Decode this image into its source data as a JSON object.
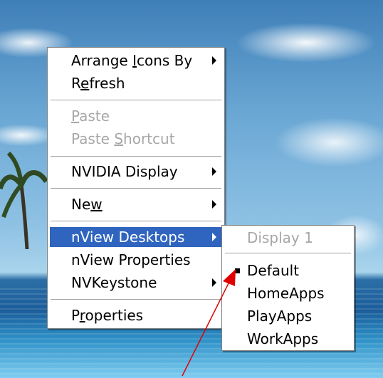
{
  "context_menu": {
    "items": [
      {
        "label": "Arrange Icons By",
        "ul_before": "Arrange ",
        "ul_char": "I",
        "ul_after": "cons By"
      },
      {
        "label": "Refresh",
        "ul_before": "R",
        "ul_char": "e",
        "ul_after": "fresh"
      },
      {
        "label": "Paste",
        "ul_before": "",
        "ul_char": "P",
        "ul_after": "aste"
      },
      {
        "label": "Paste Shortcut",
        "ul_before": "Paste ",
        "ul_char": "S",
        "ul_after": "hortcut"
      },
      {
        "label": "NVIDIA Display"
      },
      {
        "label": "New",
        "ul_before": "Ne",
        "ul_char": "w",
        "ul_after": ""
      },
      {
        "label": "nView Desktops"
      },
      {
        "label": "nView Properties"
      },
      {
        "label": "NVKeystone"
      },
      {
        "label": "Properties",
        "ul_before": "P",
        "ul_char": "r",
        "ul_after": "operties"
      }
    ]
  },
  "submenu": {
    "items": [
      {
        "label": "Display 1"
      },
      {
        "label": "Default"
      },
      {
        "label": "HomeApps"
      },
      {
        "label": "PlayApps"
      },
      {
        "label": "WorkApps"
      }
    ]
  },
  "colors": {
    "highlight": "#2f64bf",
    "disabled_text": "#a7a7a7",
    "annotation_arrow": "#e00000"
  }
}
